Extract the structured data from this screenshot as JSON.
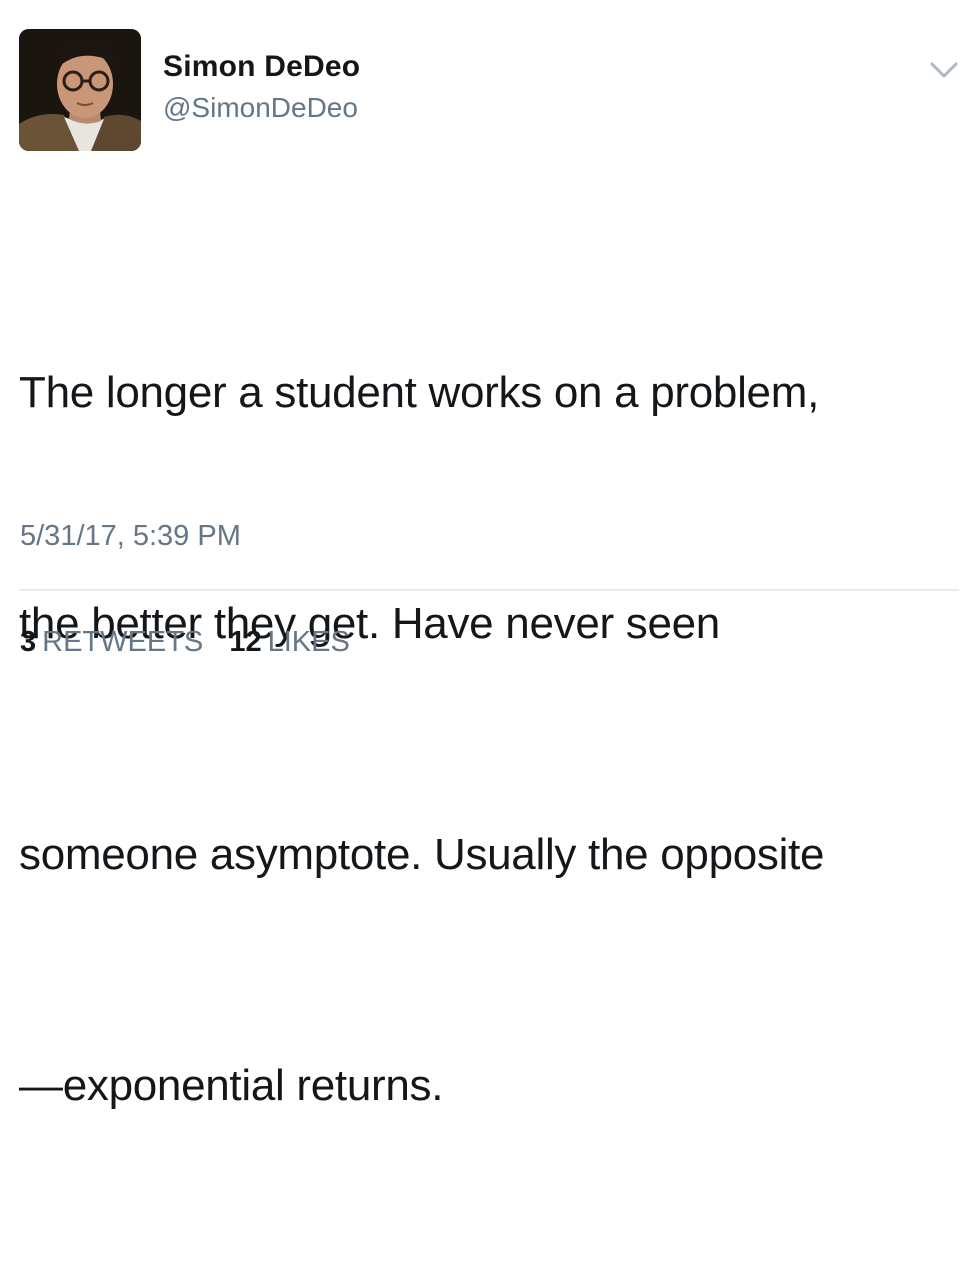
{
  "tweet": {
    "author": {
      "name": "Simon DeDeo",
      "handle": "@SimonDeDeo",
      "avatar": "profile-photo"
    },
    "menu_icon": "chevron-down-icon",
    "text_lines": [
      "The longer a student works on a problem,",
      "the better they get. Have never seen",
      "someone asymptote. Usually the opposite",
      "—exponential returns."
    ],
    "timestamp": "5/31/17, 5:39 PM",
    "stats": {
      "retweets_count": "3",
      "retweets_label": "RETWEETS",
      "likes_count": "12",
      "likes_label": "LIKES"
    }
  },
  "colors": {
    "text": "#14171a",
    "secondary": "#657786",
    "divider": "#e6ecf0"
  }
}
